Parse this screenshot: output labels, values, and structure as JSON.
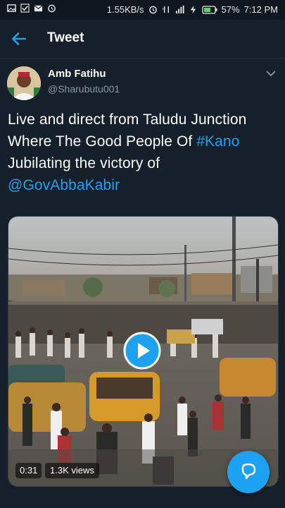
{
  "status_bar": {
    "network_speed": "1.55KB/s",
    "battery": "57%",
    "time": "7:12 PM",
    "icons": [
      "gallery-icon",
      "check-icon",
      "email-icon",
      "alarm-icon",
      "alarm-clock-icon",
      "data-icon",
      "signal-icon",
      "charging-icon",
      "battery-icon"
    ]
  },
  "header": {
    "title": "Tweet",
    "back_icon": "arrow-left-icon"
  },
  "tweet": {
    "author_name": "Amb Fatihu",
    "author_handle": "@Sharubutu001",
    "text_parts": {
      "line1": "Live and direct from Taludu Junction",
      "line2_pre": "Where The Good People Of ",
      "hashtag": "#Kano",
      "line3": "Jubilating the victory of",
      "mention": "@GovAbbaKabir"
    },
    "video": {
      "duration": "0:31",
      "views": "1.3K views"
    }
  },
  "colors": {
    "background": "#15202b",
    "accent": "#1da1f2",
    "secondary_text": "#8899a6"
  }
}
